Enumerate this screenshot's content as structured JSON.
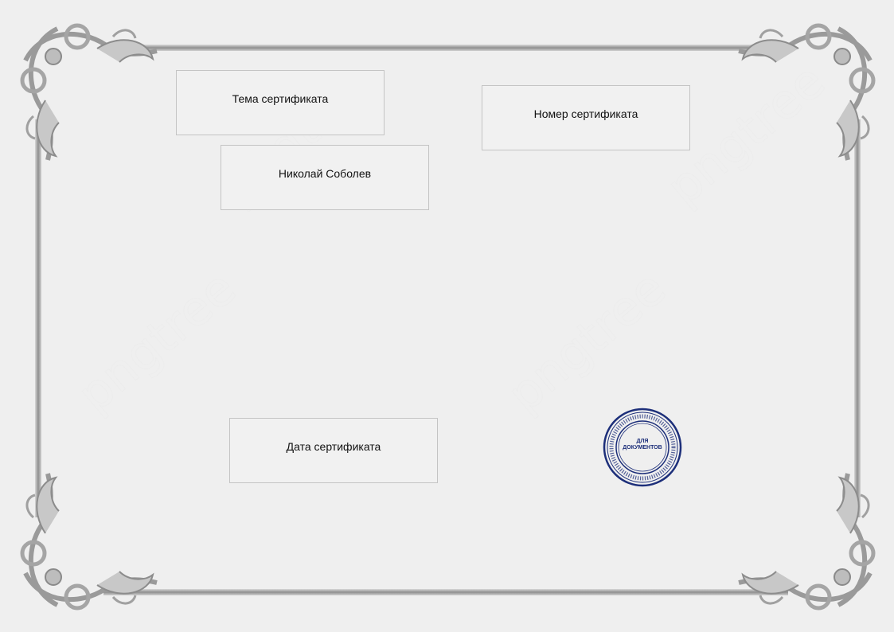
{
  "certificate": {
    "topic_placeholder": "Тема сертификата",
    "number_placeholder": "Номер сертификата",
    "recipient_name": "Николай Соболев",
    "date_placeholder": "Дата сертификата"
  },
  "stamp": {
    "center_line1": "ДЛЯ",
    "center_line2": "ДОКУМЕНТОВ",
    "color": "#1d2f7a"
  },
  "decoration": {
    "frame_color": "#a9a9a9",
    "watermark": "pngtree"
  }
}
